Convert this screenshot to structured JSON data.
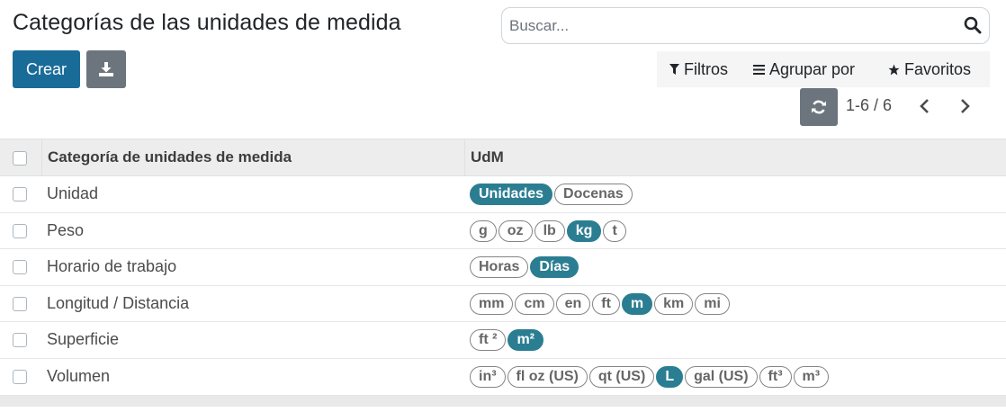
{
  "page": {
    "title": "Categorías de las unidades de medida"
  },
  "search": {
    "placeholder": "Buscar..."
  },
  "toolbar": {
    "create_label": "Crear"
  },
  "filters": {
    "filters_label": "Filtros",
    "group_label": "Agrupar por",
    "favorites_label": "Favoritos"
  },
  "pager": {
    "value": "1-6 / 6"
  },
  "colors": {
    "primary": "#1a6c98",
    "secondary": "#6c757d",
    "tag_active": "#2b7e92"
  },
  "table": {
    "headers": {
      "category": "Categoría de unidades de medida",
      "uom": "UdM"
    },
    "rows": [
      {
        "name": "Unidad",
        "tags": [
          {
            "label": "Unidades",
            "active": true
          },
          {
            "label": "Docenas",
            "active": false
          }
        ]
      },
      {
        "name": "Peso",
        "tags": [
          {
            "label": "g",
            "active": false
          },
          {
            "label": "oz",
            "active": false
          },
          {
            "label": "lb",
            "active": false
          },
          {
            "label": "kg",
            "active": true
          },
          {
            "label": "t",
            "active": false
          }
        ]
      },
      {
        "name": "Horario de trabajo",
        "tags": [
          {
            "label": "Horas",
            "active": false
          },
          {
            "label": "Días",
            "active": true
          }
        ]
      },
      {
        "name": "Longitud / Distancia",
        "tags": [
          {
            "label": "mm",
            "active": false
          },
          {
            "label": "cm",
            "active": false
          },
          {
            "label": "en",
            "active": false
          },
          {
            "label": "ft",
            "active": false
          },
          {
            "label": "m",
            "active": true
          },
          {
            "label": "km",
            "active": false
          },
          {
            "label": "mi",
            "active": false
          }
        ]
      },
      {
        "name": "Superficie",
        "tags": [
          {
            "label": "ft ²",
            "active": false
          },
          {
            "label": "m²",
            "active": true
          }
        ]
      },
      {
        "name": "Volumen",
        "tags": [
          {
            "label": "in³",
            "active": false
          },
          {
            "label": "fl oz (US)",
            "active": false
          },
          {
            "label": "qt (US)",
            "active": false
          },
          {
            "label": "L",
            "active": true
          },
          {
            "label": "gal (US)",
            "active": false
          },
          {
            "label": "ft³",
            "active": false
          },
          {
            "label": "m³",
            "active": false
          }
        ]
      }
    ]
  }
}
